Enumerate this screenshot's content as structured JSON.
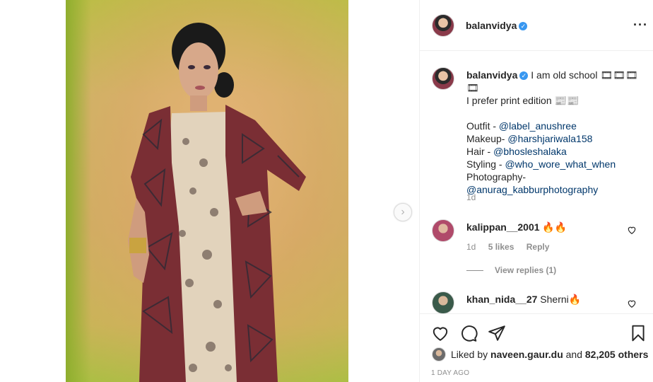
{
  "post": {
    "username": "balanvidya",
    "verified": true,
    "caption_line1": "I am old school 🎞🎞🎞🎞",
    "caption_line2": "I prefer print edition 📰📰",
    "credits": [
      {
        "label": "Outfit - ",
        "mention": "@label_anushree"
      },
      {
        "label": "Makeup- ",
        "mention": "@harshjariwala158"
      },
      {
        "label": "Hair - ",
        "mention": "@bhosleshalaka"
      },
      {
        "label": "Styling - ",
        "mention": "@who_wore_what_when"
      },
      {
        "label": "Photography-",
        "mention": ""
      },
      {
        "label": "",
        "mention": "@anurag_kabburphotography"
      }
    ],
    "caption_age": "1d"
  },
  "comments": [
    {
      "username": "kalippan__2001",
      "text": "🔥🔥",
      "age": "1d",
      "likes": "5 likes",
      "reply": "Reply",
      "view_replies": "View replies (1)"
    },
    {
      "username": "khan_nida__27",
      "text": "Sherni🔥"
    }
  ],
  "actions": {
    "liked_prefix": "Liked by ",
    "liked_user": "naveen.gaur.du",
    "liked_middle": " and ",
    "liked_count": "82,205 others",
    "time": "1 DAY AGO"
  },
  "icons": {
    "more": "more-options-icon",
    "verified": "verified-badge-icon",
    "next": "next-chevron-icon",
    "like": "heart-icon",
    "comment": "comment-bubble-icon",
    "share": "paper-plane-icon",
    "save": "bookmark-icon"
  },
  "colors": {
    "link": "#00376b",
    "verified": "#3897f0",
    "muted": "#8e8e8e",
    "border": "#efefef"
  }
}
